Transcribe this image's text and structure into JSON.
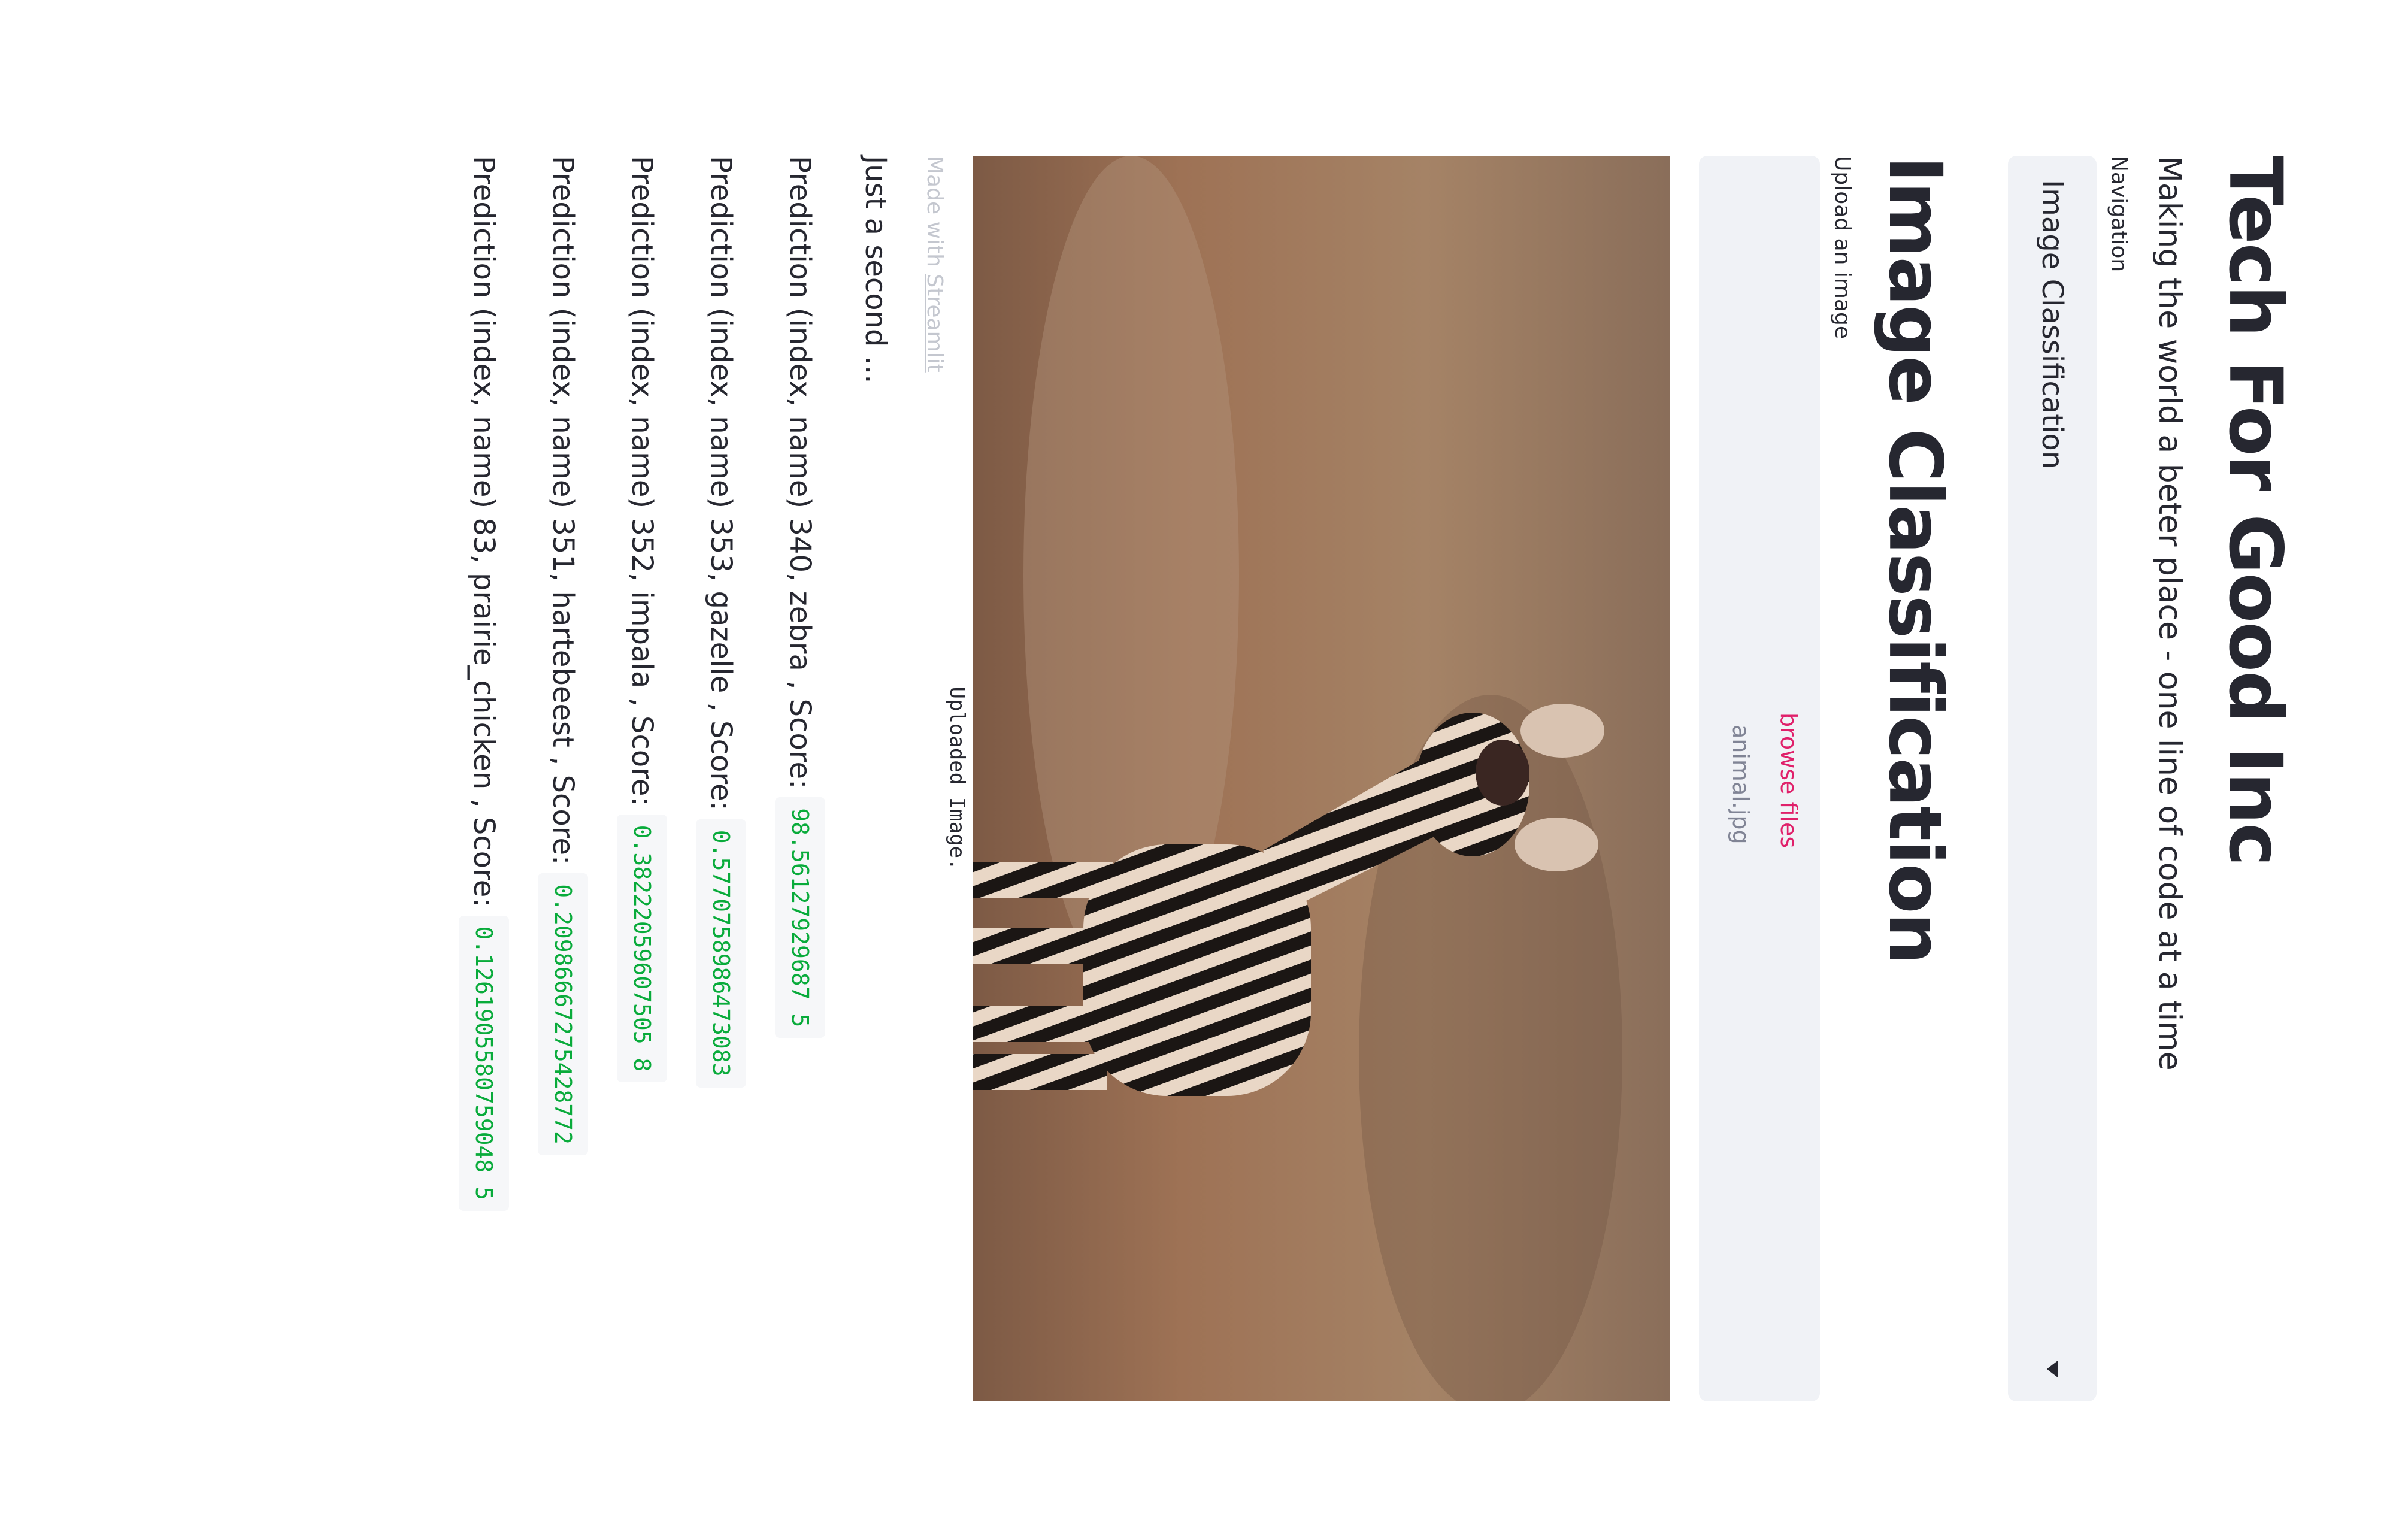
{
  "header": {
    "title": "Tech For Good Inc",
    "subtitle": "Making the world a beter place - one line of code at a time"
  },
  "navigation": {
    "label": "Navigation",
    "selected": "Image Classification"
  },
  "page": {
    "heading": "Image Classification",
    "upload_label": "Upload an image",
    "file_name": "animal.jpg",
    "browse_label": "browse files",
    "image_caption": "Uploaded Image.",
    "status": "Just a second ..."
  },
  "predictions": [
    {
      "prefix": "Prediction (index, name) 340, zebra , Score:",
      "score": "98.56127929687 5"
    },
    {
      "prefix": "Prediction (index, name) 353, gazelle , Score:",
      "score": "0.5770758986473083"
    },
    {
      "prefix": "Prediction (index, name) 352, impala , Score:",
      "score": "0.38222059607505 8"
    },
    {
      "prefix": "Prediction (index, name) 351, hartebeest , Score:",
      "score": "0.20986667275428772"
    },
    {
      "prefix": "Prediction (index, name) 83, prairie_chicken , Score:",
      "score": "0.1261905580759048 5"
    }
  ],
  "footer": {
    "made_with": "Made with",
    "link": "Streamlit"
  },
  "colors": {
    "score_green": "#09ab3b",
    "browse_pink": "#e0206a",
    "panel_gray": "#f0f2f6"
  }
}
